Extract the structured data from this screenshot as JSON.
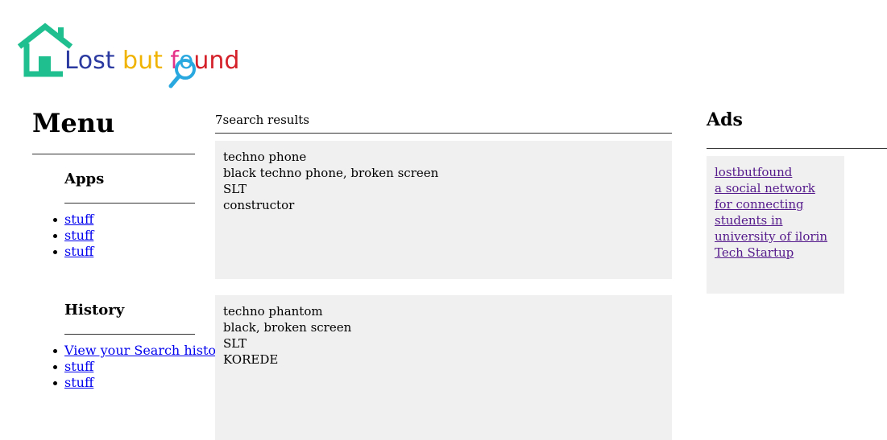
{
  "logo": {
    "letters": [
      {
        "ch": "L",
        "color": "#2b3aa0"
      },
      {
        "ch": "o",
        "color": "#2b3aa0"
      },
      {
        "ch": "s",
        "color": "#2b3aa0"
      },
      {
        "ch": "t",
        "color": "#2b3aa0"
      },
      {
        "ch": " ",
        "color": "#000000"
      },
      {
        "ch": "b",
        "color": "#f0b400"
      },
      {
        "ch": "u",
        "color": "#f0b400"
      },
      {
        "ch": "t",
        "color": "#f0b400"
      },
      {
        "ch": " ",
        "color": "#000000"
      },
      {
        "ch": "f",
        "color": "#e6338a"
      },
      {
        "ch": "o",
        "color": "#29a8e0"
      },
      {
        "ch": "u",
        "color": "#d4212a"
      },
      {
        "ch": "n",
        "color": "#d4212a"
      },
      {
        "ch": "d",
        "color": "#d4212a"
      }
    ],
    "house_color": "#1fbf8f",
    "magnifier_color": "#29a8e0",
    "icons": [
      "house-icon",
      "magnifier-icon"
    ]
  },
  "menu": {
    "title": "Menu",
    "apps": {
      "heading": "Apps",
      "items": [
        "stuff",
        "stuff",
        "stuff"
      ]
    },
    "history": {
      "heading": "History",
      "items": [
        "View your Search history",
        "stuff",
        "stuff"
      ]
    }
  },
  "results": {
    "count": "7search results",
    "items": [
      {
        "name": "techno phone",
        "description": "black techno phone, broken screen",
        "location": "SLT",
        "finder": "constructor"
      },
      {
        "name": "techno phantom",
        "description": "black, broken screen",
        "location": "SLT",
        "finder": "KOREDE"
      }
    ]
  },
  "ads": {
    "title": "Ads",
    "links": [
      "lostbutfound",
      "a social network for connecting students in university of ilorin",
      "Tech Startup"
    ]
  }
}
